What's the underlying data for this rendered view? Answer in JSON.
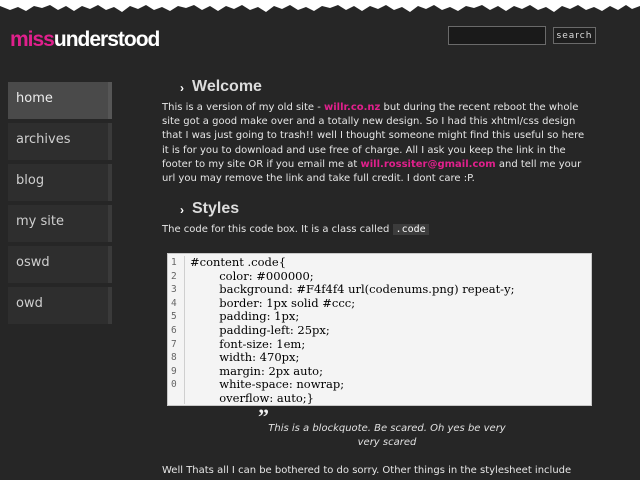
{
  "site": {
    "logo_pink": "miss",
    "logo_white": "understood"
  },
  "search": {
    "placeholder": "",
    "button_label": "search"
  },
  "nav": {
    "items": [
      {
        "label": "home",
        "active": true
      },
      {
        "label": "archives",
        "active": false
      },
      {
        "label": "blog",
        "active": false
      },
      {
        "label": "my site",
        "active": false
      },
      {
        "label": "oswd",
        "active": false
      },
      {
        "label": "owd",
        "active": false
      }
    ]
  },
  "welcome": {
    "heading": "Welcome",
    "p1": "This is a version of my old site - ",
    "link1": "willr.co.nz",
    "p2": " but during the recent reboot the whole site got a good make over and a totally new design. So I had this xhtml/css design that I was just going to trash!! well I thought someone might find this useful so here it is for you to download and use free of charge. All I ask you keep the link in the footer to my site OR if you email me at ",
    "link2": "will.rossiter@gmail.com",
    "p3": " and tell me your url you may remove the link and take full credit. I dont care :P."
  },
  "styles": {
    "heading": "Styles",
    "intro": "The code for this code box. It is a class called ",
    "class_name": ".code"
  },
  "codebox": {
    "line_numbers": [
      "1",
      "2",
      "3",
      "4",
      "5",
      "6",
      "7",
      "8",
      "9",
      "0"
    ],
    "lines": [
      "#content .code{",
      "        color: #000000;",
      "        background: #F4f4f4 url(codenums.png) repeat-y;",
      "        border: 1px solid #ccc;",
      "        padding: 1px;",
      "        padding-left: 25px;",
      "        font-size: 1em;",
      "        width: 470px;",
      "        margin: 2px auto;",
      "        white-space: nowrap;",
      "        overflow: auto;}"
    ]
  },
  "quote": {
    "mark": "”",
    "text": "This is a blockquote. Be scared. Oh yes be very very scared"
  },
  "footer": {
    "text": "Well Thats all I can be bothered to do sorry. Other things in the stylesheet include"
  },
  "colors": {
    "accent": "#e0208c",
    "background": "#262626",
    "code_bg": "#f4f4f4"
  }
}
